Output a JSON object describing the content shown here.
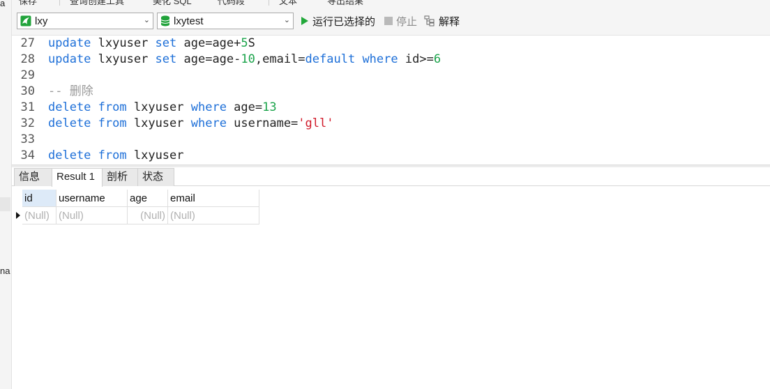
{
  "left_panel": {
    "frag_top": "a",
    "frag_mid": "na"
  },
  "top_toolbar": {
    "items": [
      "保存",
      "查询创建工具",
      "美化 SQL",
      "代码段",
      "文本",
      "导出结果"
    ]
  },
  "query_toolbar": {
    "connection": "lxy",
    "database": "lxytest",
    "run_label": "运行已选择的",
    "stop_label": "停止",
    "explain_label": "解释"
  },
  "editor": {
    "lines": [
      {
        "n": "27",
        "tokens": [
          [
            "kw",
            "update"
          ],
          [
            "plain",
            " lxyuser "
          ],
          [
            "kw",
            "set"
          ],
          [
            "plain",
            " age=age+"
          ],
          [
            "num",
            "5"
          ],
          [
            "plain",
            "S"
          ]
        ]
      },
      {
        "n": "28",
        "tokens": [
          [
            "kw",
            "update"
          ],
          [
            "plain",
            " lxyuser "
          ],
          [
            "kw",
            "set"
          ],
          [
            "plain",
            " age=age-"
          ],
          [
            "num",
            "10"
          ],
          [
            "plain",
            ",email="
          ],
          [
            "kw",
            "default"
          ],
          [
            "plain",
            " "
          ],
          [
            "kw",
            "where"
          ],
          [
            "plain",
            " id>="
          ],
          [
            "num",
            "6"
          ]
        ]
      },
      {
        "n": "29",
        "tokens": []
      },
      {
        "n": "30",
        "tokens": [
          [
            "cmt",
            "-- 删除"
          ]
        ]
      },
      {
        "n": "31",
        "tokens": [
          [
            "kw",
            "delete"
          ],
          [
            "plain",
            " "
          ],
          [
            "kw",
            "from"
          ],
          [
            "plain",
            " lxyuser "
          ],
          [
            "kw",
            "where"
          ],
          [
            "plain",
            " age="
          ],
          [
            "num",
            "13"
          ]
        ]
      },
      {
        "n": "32",
        "tokens": [
          [
            "kw",
            "delete"
          ],
          [
            "plain",
            " "
          ],
          [
            "kw",
            "from"
          ],
          [
            "plain",
            " lxyuser "
          ],
          [
            "kw",
            "where"
          ],
          [
            "plain",
            " username="
          ],
          [
            "str",
            "'gll'"
          ]
        ]
      },
      {
        "n": "33",
        "tokens": []
      },
      {
        "n": "34",
        "tokens": [
          [
            "kw",
            "delete"
          ],
          [
            "plain",
            " "
          ],
          [
            "kw",
            "from"
          ],
          [
            "plain",
            " lxyuser"
          ]
        ]
      }
    ]
  },
  "tabs": [
    {
      "label": "信息",
      "active": false
    },
    {
      "label": "Result 1",
      "active": true
    },
    {
      "label": "剖析",
      "active": false
    },
    {
      "label": "状态",
      "active": false
    }
  ],
  "grid": {
    "columns": [
      "id",
      "username",
      "age",
      "email"
    ],
    "rows": [
      [
        "(Null)",
        "(Null)",
        "(Null)",
        "(Null)"
      ]
    ]
  },
  "colors": {
    "keyword": "#1d6fd8",
    "number": "#1aa34a",
    "string": "#d11a2a",
    "comment": "#999999",
    "run_green": "#22a83a"
  }
}
